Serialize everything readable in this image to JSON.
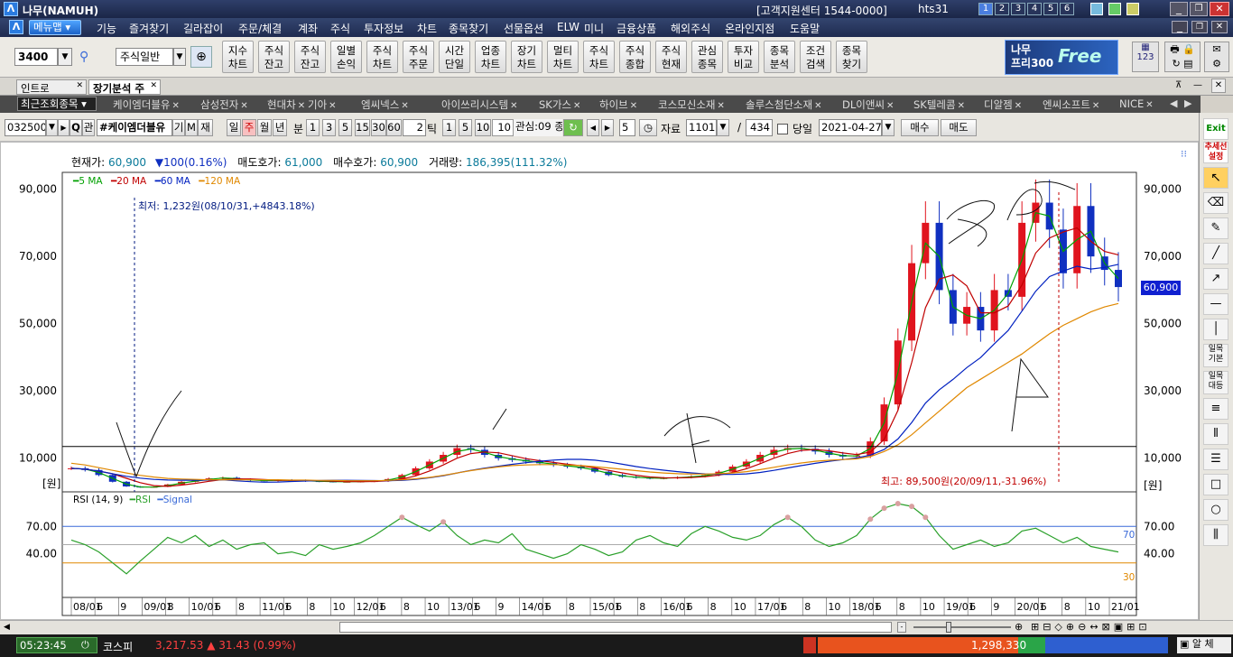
{
  "title": {
    "app_name": "나무(NAMUH)",
    "support": "[고객지원센터 1544-0000]",
    "user": "hts31",
    "pages": [
      "1",
      "2",
      "3",
      "4",
      "5",
      "6"
    ]
  },
  "menu": {
    "menu_button": "메뉴맵",
    "items": [
      "기능",
      "즐겨찾기",
      "길라잡이",
      "주문/체결",
      "계좌",
      "주식",
      "투자정보",
      "차트",
      "종목찾기",
      "선물옵션",
      "ELW",
      "미니",
      "금융상품",
      "해외주식",
      "온라인지점",
      "도움말"
    ]
  },
  "toolbar": {
    "screen_no": "3400",
    "category": "주식일반",
    "buttons": [
      "지수\n차트",
      "주식\n잔고",
      "주식\n잔고",
      "일별\n손익",
      "주식\n차트",
      "주식\n주문",
      "시간\n단일",
      "업종\n차트",
      "장기\n차트",
      "멀티\n차트",
      "주식\n차트",
      "주식\n종합",
      "주식\n현재",
      "관심\n종목",
      "투자\n비교",
      "종목\n분석",
      "조건\n검색",
      "종목\n찾기"
    ],
    "banner_left": "나무\n프리300",
    "banner_right": "Free",
    "keyboard_label": "123"
  },
  "tabs": [
    "인트로",
    "장기분석 주"
  ],
  "recent": {
    "label": "최근조회종목",
    "stocks": [
      "케이엠더블유",
      "삼성전자",
      "현대차",
      "기아",
      "엠씨넥스",
      "아이쓰리시스템",
      "SK가스",
      "하이브",
      "코스모신소재",
      "솔루스첨단소재",
      "DL이앤씨",
      "SK텔레콤",
      "디알젬",
      "엔씨소프트",
      "NICE"
    ]
  },
  "controls": {
    "code": "032500",
    "name": "#케이엠더블유",
    "q": "Q",
    "gwan": "관",
    "gi": "기",
    "m": "M",
    "jae": "재",
    "periods": [
      "일",
      "주",
      "월",
      "년"
    ],
    "bun": "분",
    "minutes": [
      "1",
      "3",
      "5",
      "15",
      "30",
      "60"
    ],
    "tick_val": "2",
    "tick_label": "틱",
    "ticks": [
      "1",
      "5",
      "10",
      "10"
    ],
    "interest": "관심:09 종",
    "count": "5",
    "data_label": "자료",
    "data_count": "1101",
    "slash": "/",
    "total": "434",
    "today_label": "당일",
    "date": "2021-04-27",
    "buy": "매수",
    "sell": "매도"
  },
  "quote": {
    "price_label": "현재가:",
    "price": "60,900",
    "change": "100(0.16%)",
    "ask_label": "매도호가:",
    "ask": "61,000",
    "bid_label": "매수호가:",
    "bid": "60,900",
    "vol_label": "거래량:",
    "vol": "186,395(111.32%)"
  },
  "legend": {
    "ma5": "5 MA",
    "ma20": "20 MA",
    "ma60": "60 MA",
    "ma120": "120 MA"
  },
  "annotations": {
    "low": "최저: 1,232원(08/10/31,+4843.18%)",
    "high": "최고: 89,500원(20/09/11,-31.96%)",
    "current_tag": "60,900",
    "rsi_legend": "RSI (14, 9)",
    "rsi_name": "RSI",
    "signal_name": "Signal",
    "rsi_hi": "70",
    "rsi_lo": "30"
  },
  "colors": {
    "up": "#e0141e",
    "down": "#1030c0",
    "ma5": "#00a000",
    "ma20": "#c00000",
    "ma60": "#0020c0",
    "ma120": "#e08800",
    "rsi": "#2aa02a",
    "signal": "#3a6ad8"
  },
  "chart_data": {
    "type": "line",
    "title": "",
    "y_ticks": [
      "90,000",
      "70,000",
      "50,000",
      "30,000",
      "10,000"
    ],
    "y_unit": "[원]",
    "ylim": [
      0,
      95000
    ],
    "rsi_ticks": [
      "70.00",
      "40.00"
    ],
    "x_labels": [
      "08/01",
      "6",
      "9",
      "09/01",
      "8",
      "10/01",
      "6",
      "8",
      "11/01",
      "6",
      "8",
      "10",
      "12/01",
      "6",
      "8",
      "10",
      "13/01",
      "6",
      "9",
      "14/01",
      "6",
      "8",
      "15/01",
      "6",
      "8",
      "16/01",
      "6",
      "8",
      "10",
      "17/01",
      "6",
      "8",
      "10",
      "18/01",
      "6",
      "8",
      "10",
      "19/01",
      "6",
      "9",
      "20/01",
      "6",
      "8",
      "10",
      "21/01"
    ],
    "close_weekly": [
      7000,
      6500,
      5000,
      3000,
      1600,
      1300,
      1500,
      2200,
      3000,
      3400,
      4000,
      4200,
      3700,
      3400,
      3300,
      3500,
      3400,
      3200,
      3100,
      3000,
      3000,
      3100,
      3200,
      3800,
      5000,
      7000,
      9000,
      11000,
      13000,
      12500,
      11000,
      10000,
      9500,
      9000,
      8500,
      8000,
      7500,
      7000,
      6000,
      5000,
      4500,
      4200,
      4000,
      4100,
      4300,
      4600,
      5000,
      6000,
      7500,
      9000,
      11000,
      12500,
      13000,
      12800,
      12000,
      11000,
      10500,
      10800,
      15000,
      26000,
      45000,
      68000,
      80000,
      60000,
      50000,
      55000,
      48000,
      60000,
      58000,
      80000,
      86000,
      78000,
      65000,
      85000,
      70000,
      66000,
      60900
    ],
    "ma120_weekly": [
      8500,
      8000,
      7200,
      6400,
      5600,
      4900,
      4400,
      4000,
      3800,
      3700,
      3600,
      3600,
      3600,
      3600,
      3600,
      3600,
      3500,
      3500,
      3400,
      3400,
      3300,
      3300,
      3300,
      3400,
      3600,
      3900,
      4300,
      4900,
      5600,
      6300,
      6900,
      7400,
      7800,
      8000,
      8100,
      8100,
      8000,
      7800,
      7500,
      7100,
      6700,
      6300,
      5900,
      5600,
      5400,
      5300,
      5300,
      5400,
      5600,
      6000,
      6600,
      7300,
      8000,
      8600,
      9100,
      9400,
      9600,
      9800,
      10500,
      12000,
      14000,
      17000,
      20500,
      24000,
      27500,
      31000,
      33500,
      36000,
      38500,
      41000,
      44000,
      47000,
      49500,
      51500,
      53500,
      55000,
      56000
    ],
    "rsi_weekly": [
      55,
      50,
      42,
      30,
      18,
      32,
      45,
      58,
      52,
      60,
      48,
      55,
      45,
      50,
      52,
      40,
      42,
      38,
      50,
      45,
      48,
      52,
      60,
      70,
      80,
      72,
      65,
      75,
      60,
      50,
      55,
      52,
      62,
      45,
      40,
      35,
      40,
      50,
      45,
      38,
      42,
      55,
      60,
      52,
      48,
      62,
      70,
      65,
      58,
      55,
      60,
      72,
      80,
      70,
      55,
      48,
      52,
      60,
      78,
      90,
      95,
      92,
      80,
      60,
      45,
      50,
      55,
      48,
      52,
      65,
      68,
      60,
      52,
      58,
      48,
      45,
      42
    ]
  }
}
